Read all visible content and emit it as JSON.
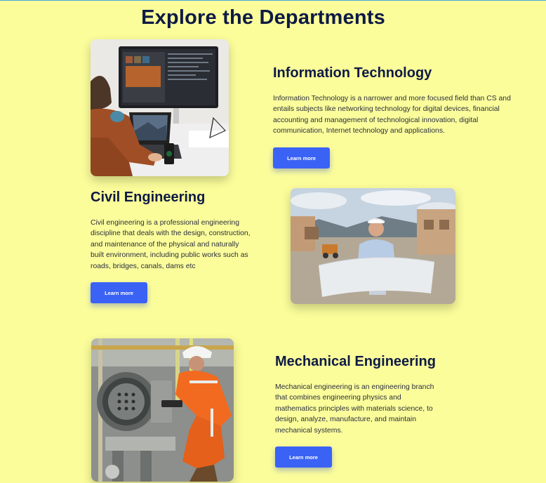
{
  "page": {
    "title": "Explore the Departments"
  },
  "departments": [
    {
      "title": "Information Technology",
      "description": "Information Technology is a narrower and more focused field than CS and entails subjects like networking technology for digital devices, financial accounting and management of technological innovation, digital communication, Internet technology and applications.",
      "button_label": "Learn more",
      "image_icon": "laptop-desk-photo"
    },
    {
      "title": "Civil Engineering",
      "description": "Civil engineering is a professional engineering discipline that deals with the design, construction, and maintenance of the physical and naturally built environment, including public works such as roads, bridges, canals, dams etc",
      "button_label": "Learn more",
      "image_icon": "engineer-blueprint-photo"
    },
    {
      "title": "Mechanical Engineering",
      "description": "Mechanical engineering is an engineering branch that combines engineering physics and mathematics principles with materials science, to design, analyze, manufacture, and maintain mechanical systems.",
      "button_label": "Learn more",
      "image_icon": "worker-machinery-photo"
    }
  ],
  "colors": {
    "background": "#fbfd9b",
    "heading": "#0e1a44",
    "button": "#3a63f5"
  }
}
